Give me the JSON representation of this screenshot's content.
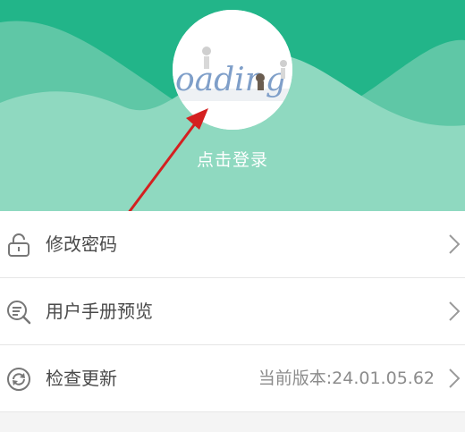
{
  "header": {
    "login_label": "点击登录",
    "avatar_text": "oading",
    "colors": {
      "background": "#22b589",
      "wave_light": "#8fd9c0"
    }
  },
  "menu": [
    {
      "label": "修改密码",
      "icon": "unlock-icon",
      "value": ""
    },
    {
      "label": "用户手册预览",
      "icon": "manual-search-icon",
      "value": ""
    },
    {
      "label": "检查更新",
      "icon": "refresh-icon",
      "value": "当前版本:24.01.05.62"
    }
  ],
  "colors": {
    "arrow": "#d42020",
    "text": "#4a4a4a",
    "muted": "#8c8c8c",
    "icon": "#777777"
  }
}
